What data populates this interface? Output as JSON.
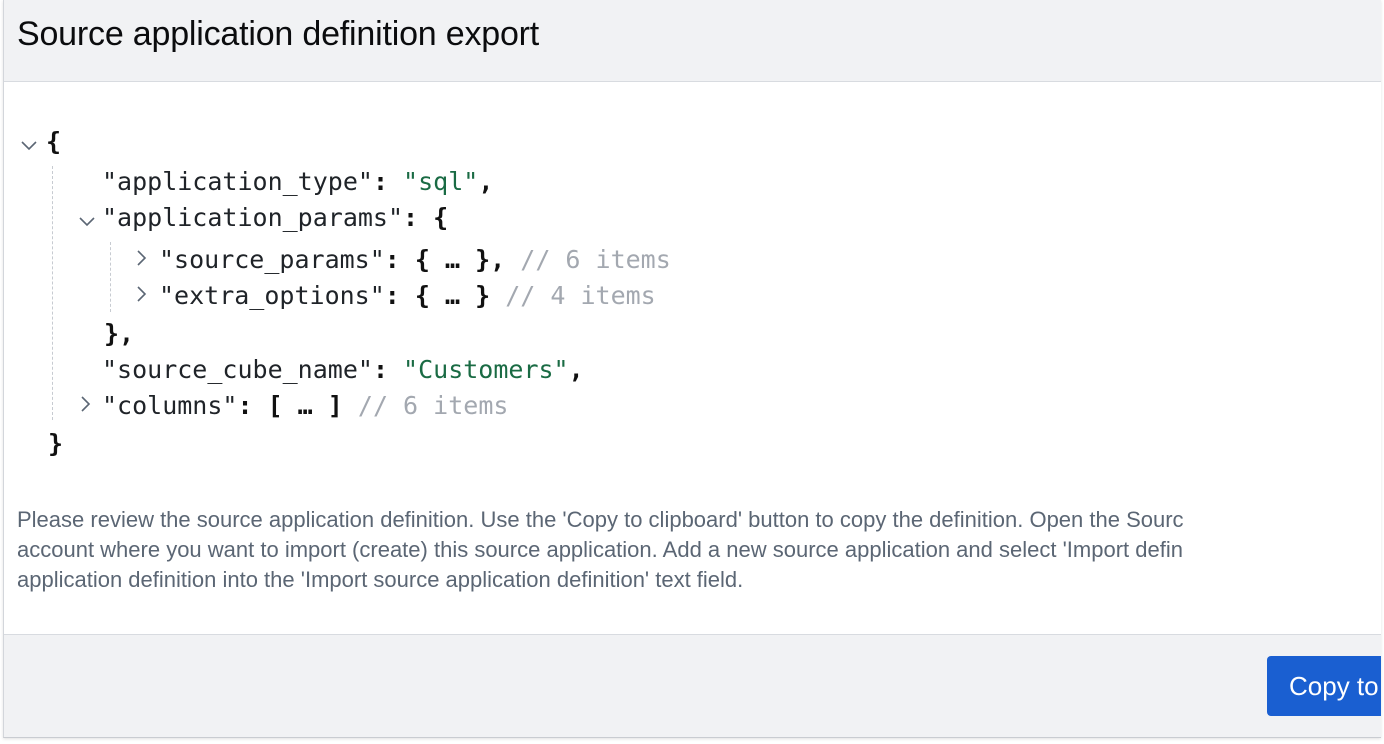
{
  "dialog": {
    "title": "Source application definition export"
  },
  "json_tree": {
    "open_brace": "{",
    "close_brace": "}",
    "application_type_key": "\"application_type\"",
    "application_type_value": "\"sql\"",
    "application_params_key": "\"application_params\"",
    "source_params_key": "\"source_params\"",
    "source_params_comment": "// 6 items",
    "extra_options_key": "\"extra_options\"",
    "extra_options_comment": "// 4 items",
    "source_cube_name_key": "\"source_cube_name\"",
    "source_cube_name_value": "\"Customers\"",
    "columns_key": "\"columns\"",
    "columns_comment": "// 6 items",
    "params_close": "},",
    "collapsed_object": "{ … }",
    "collapsed_array": "[ … ]"
  },
  "description": {
    "line1": "Please review the source application definition. Use the 'Copy to clipboard' button to copy the definition. Open the Sourc",
    "line2": "account where you want to import (create) this source application. Add a new source application and select 'Import defin",
    "line3": "application definition into the 'Import source application definition' text field."
  },
  "footer": {
    "copy_button_label": "Copy to clipboard"
  },
  "colors": {
    "header_bg": "#f1f2f4",
    "string_value": "#1a6b44",
    "comment": "#a3a8b0",
    "primary_button": "#1a5fd1",
    "description_text": "#5b6674"
  },
  "icons": [
    "chevron-down-icon",
    "chevron-right-icon"
  ]
}
